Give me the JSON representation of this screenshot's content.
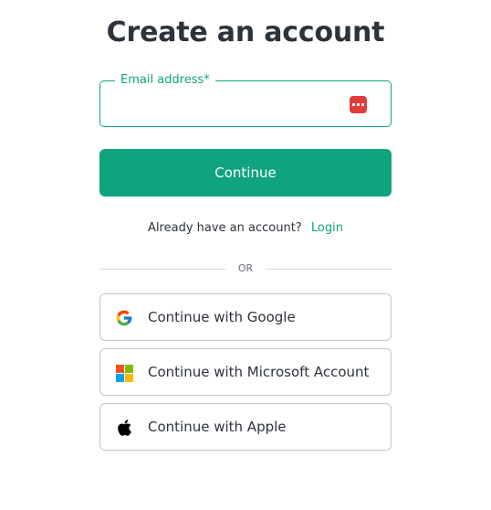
{
  "title": "Create an account",
  "email": {
    "label": "Email address*",
    "value": "",
    "placeholder": ""
  },
  "continue_label": "Continue",
  "login_prompt": {
    "text": "Already have an account?",
    "link": "Login"
  },
  "divider_text": "OR",
  "social": [
    {
      "label": "Continue with Google",
      "icon": "google-icon"
    },
    {
      "label": "Continue with Microsoft Account",
      "icon": "microsoft-icon"
    },
    {
      "label": "Continue with Apple",
      "icon": "apple-icon"
    }
  ],
  "colors": {
    "accent": "#10a37f",
    "text": "#2d333a",
    "border": "#c2c8d0",
    "password_manager_icon": "#e23b3b"
  }
}
